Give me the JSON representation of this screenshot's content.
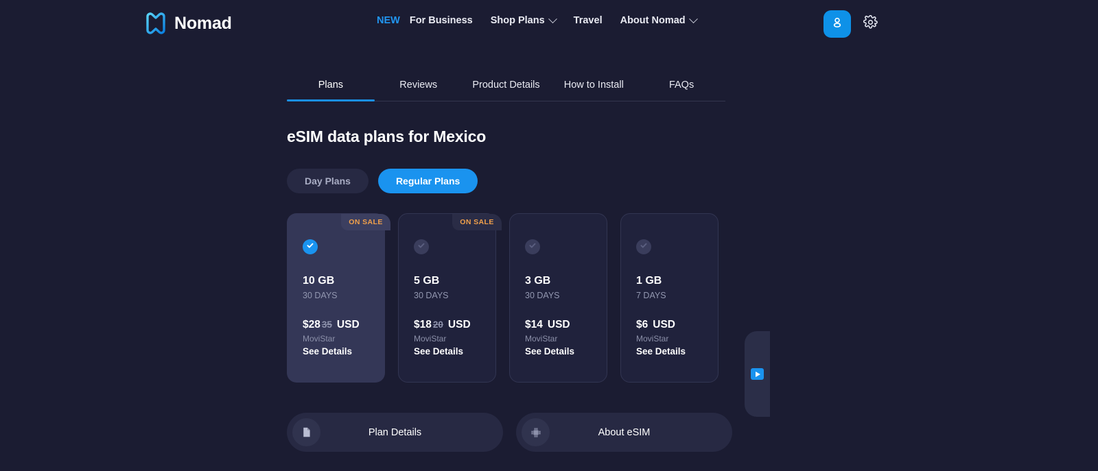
{
  "header": {
    "brand": "Nomad",
    "logo_icon": "nomad-logo-icon",
    "nav": [
      {
        "badge": "NEW",
        "label": "For Business",
        "caret": false
      },
      {
        "badge": "",
        "label": "Shop Plans",
        "caret": true
      },
      {
        "badge": "",
        "label": "Travel",
        "caret": false
      },
      {
        "badge": "",
        "label": "About Nomad",
        "caret": true
      }
    ],
    "account_icon": "user-icon",
    "settings_icon": "gear-icon",
    "accent_color": "#1a93ef"
  },
  "tabs": [
    {
      "label": "Plans",
      "active": true
    },
    {
      "label": "Reviews",
      "active": false
    },
    {
      "label": "Product Details",
      "active": false
    },
    {
      "label": "How to Install",
      "active": false
    },
    {
      "label": "FAQs",
      "active": false
    }
  ],
  "main": {
    "title": "eSIM data plans for Mexico",
    "segments": [
      {
        "label": "Day Plans",
        "active": false
      },
      {
        "label": "Regular Plans",
        "active": true
      }
    ],
    "sale_badge_label": "ON SALE",
    "see_details_label": "See Details",
    "plans": [
      {
        "size": "10 GB",
        "duration": "30 DAYS",
        "price": "$28",
        "old_price": "35",
        "currency": "USD",
        "carrier": "MoviStar",
        "on_sale": true,
        "selected": true
      },
      {
        "size": "5 GB",
        "duration": "30 DAYS",
        "price": "$18",
        "old_price": "20",
        "currency": "USD",
        "carrier": "MoviStar",
        "on_sale": true,
        "selected": false
      },
      {
        "size": "3 GB",
        "duration": "30 DAYS",
        "price": "$14",
        "old_price": "",
        "currency": "USD",
        "carrier": "MoviStar",
        "on_sale": false,
        "selected": false
      },
      {
        "size": "1 GB",
        "duration": "7 DAYS",
        "price": "$6",
        "old_price": "",
        "currency": "USD",
        "carrier": "MoviStar",
        "on_sale": false,
        "selected": false
      }
    ],
    "bottom_buttons": [
      {
        "label": "Plan Details",
        "icon": "document-icon"
      },
      {
        "label": "About eSIM",
        "icon": "sim-chip-icon"
      }
    ]
  },
  "side_widget": {
    "icon": "play-icon"
  },
  "colors": {
    "page_bg": "#1b1c32",
    "card_bg": "#20223c",
    "card_selected_bg": "#343757",
    "accent": "#1a93ef",
    "sale_text": "#f0a04b"
  }
}
